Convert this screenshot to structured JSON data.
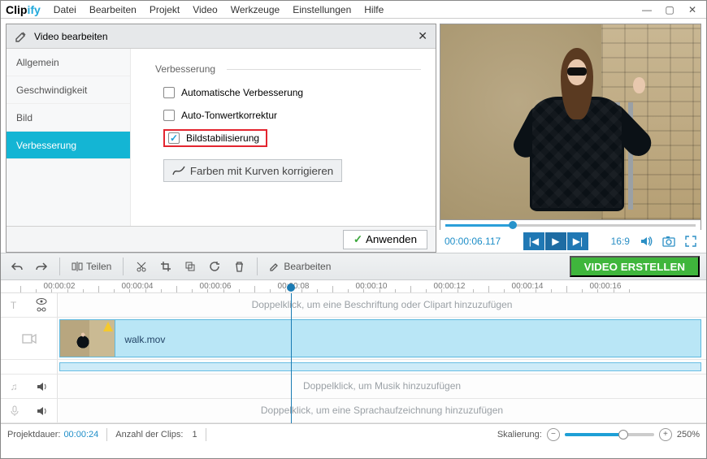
{
  "brand": {
    "p1": "Clip",
    "p2": "ify"
  },
  "menu": [
    "Datei",
    "Bearbeiten",
    "Projekt",
    "Video",
    "Werkzeuge",
    "Einstellungen",
    "Hilfe"
  ],
  "panel": {
    "title": "Video bearbeiten",
    "tabs": [
      "Allgemein",
      "Geschwindigkeit",
      "Bild",
      "Verbesserung"
    ],
    "active_tab": 3,
    "group": "Verbesserung",
    "opts": [
      {
        "label": "Automatische Verbesserung",
        "checked": false,
        "hl": false
      },
      {
        "label": "Auto-Tonwertkorrektur",
        "checked": false,
        "hl": false
      },
      {
        "label": "Bildstabilisierung",
        "checked": true,
        "hl": true
      }
    ],
    "curves": "Farben mit Kurven korrigieren",
    "apply": "Anwenden"
  },
  "preview": {
    "timecode": "00:00:06.117",
    "ratio": "16:9"
  },
  "toolbar": {
    "split": "Teilen",
    "edit": "Bearbeiten",
    "create": "VIDEO ERSTELLEN"
  },
  "ruler": [
    "00:00:02",
    "00:00:04",
    "00:00:06",
    "00:00:08",
    "00:00:10",
    "00:00:12",
    "00:00:14",
    "00:00:16"
  ],
  "tracks": {
    "caption_hint": "Doppelklick, um eine Beschriftung oder Clipart hinzuzufügen",
    "clip": "walk.mov",
    "music_hint": "Doppelklick, um Musik hinzuzufügen",
    "voice_hint": "Doppelklick, um eine Sprachaufzeichnung hinzuzufügen"
  },
  "status": {
    "dur_label": "Projektdauer:",
    "dur": "00:00:24",
    "clips_label": "Anzahl der Clips:",
    "clips": "1",
    "scale_label": "Skalierung:",
    "scale": "250%"
  }
}
